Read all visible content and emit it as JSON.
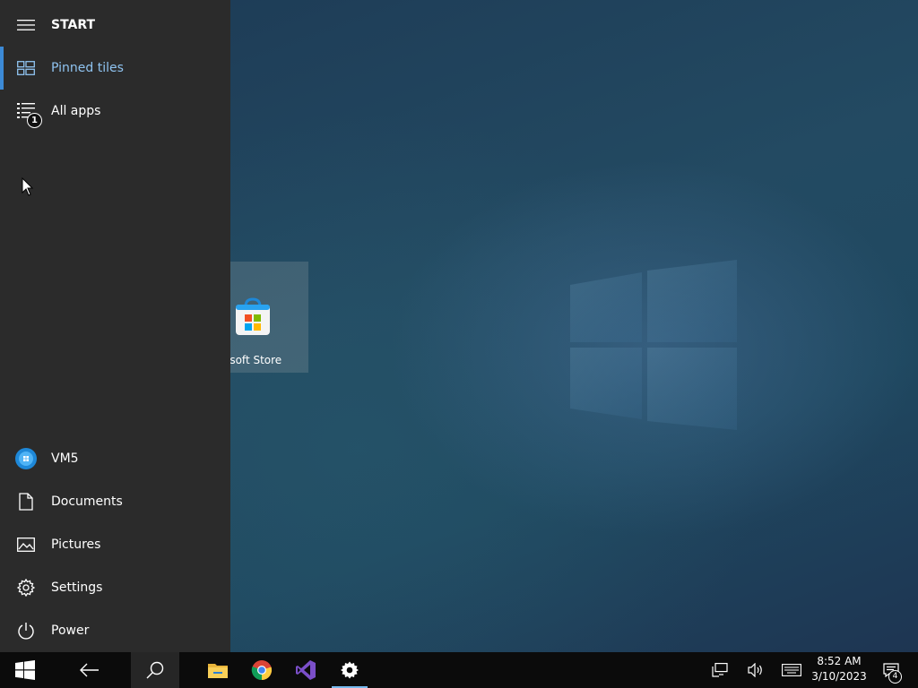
{
  "start_menu": {
    "title": "START",
    "items": [
      {
        "label": "Pinned tiles"
      },
      {
        "label": "All apps",
        "badge": "1"
      }
    ],
    "bottom_items": [
      {
        "label": "VM5"
      },
      {
        "label": "Documents"
      },
      {
        "label": "Pictures"
      },
      {
        "label": "Settings"
      },
      {
        "label": "Power"
      }
    ]
  },
  "tiles": [
    {
      "label": "osoft Store",
      "icon": "microsoft-store-icon"
    }
  ],
  "taskbar": {
    "apps": [
      "file-explorer-icon",
      "chrome-icon",
      "visual-studio-icon",
      "settings-gear-icon"
    ],
    "clock": {
      "time": "8:52 AM",
      "date": "3/10/2023"
    },
    "notification_count": "4"
  },
  "colors": {
    "accent": "#3c8ad6",
    "start_bg": "#2b2b2b",
    "taskbar_bg": "#0b0b0b",
    "pinned_text": "#8fc3f0"
  }
}
